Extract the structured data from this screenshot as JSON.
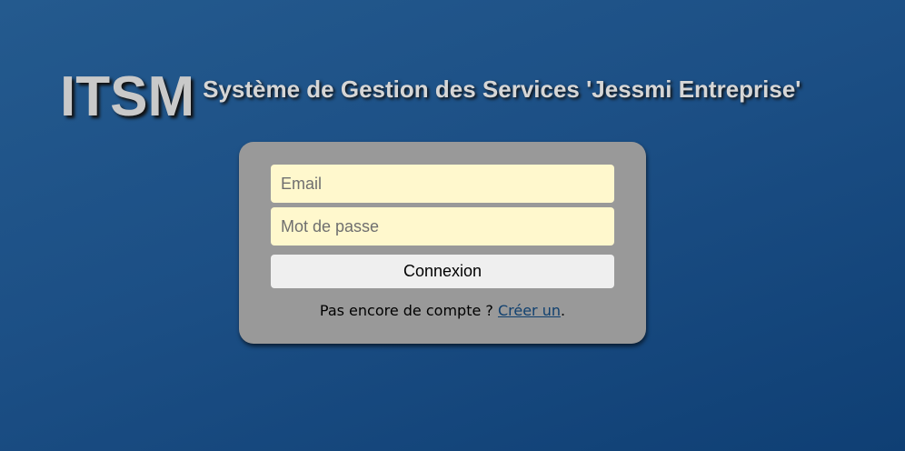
{
  "header": {
    "logo": "ITSM",
    "subtitle": "Système de Gestion des Services 'Jessmi Entreprise'"
  },
  "login_form": {
    "email_placeholder": "Email",
    "password_placeholder": "Mot de passe",
    "submit_label": "Connexion",
    "signup_prompt": "Pas encore de compte ? ",
    "signup_link": "Créer un",
    "signup_suffix": "."
  },
  "colors": {
    "background_top": "#245a8e",
    "background_bottom": "#0f3f74",
    "panel": "#999999",
    "field": "#fff8cd",
    "link": "#10406f"
  }
}
